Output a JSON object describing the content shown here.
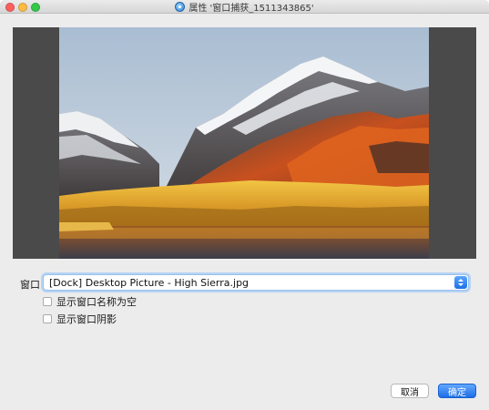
{
  "window": {
    "title": "属性 '窗口捕获_1511343865'",
    "title_icon": "obs-source-icon"
  },
  "preview": {
    "image": "macOS High Sierra wallpaper (mountain lake at sunset)",
    "colors": {
      "background": "#4a4a4a",
      "sky": "#b9c9d8",
      "foliage": "#e8a21d"
    }
  },
  "form": {
    "window_label": "窗口",
    "window_value": "[Dock] Desktop Picture - High Sierra.jpg",
    "checkbox_show_empty": "显示窗口名称为空",
    "checkbox_shadow": "显示窗口阴影"
  },
  "buttons": {
    "cancel": "取消",
    "ok": "确定"
  },
  "colors": {
    "accent": "#1c6de6",
    "focus_ring": "#b6d3f5"
  }
}
